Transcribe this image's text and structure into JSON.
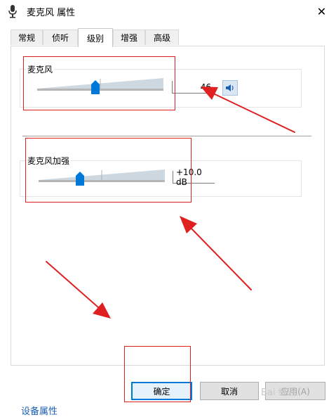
{
  "window": {
    "title": "麦克风 属性",
    "close_symbol": "✕"
  },
  "tabs": [
    {
      "label": "常规",
      "active": false
    },
    {
      "label": "侦听",
      "active": false
    },
    {
      "label": "级别",
      "active": true
    },
    {
      "label": "增强",
      "active": false
    },
    {
      "label": "高级",
      "active": false
    }
  ],
  "levels": {
    "mic": {
      "label": "麦克风",
      "value": "46",
      "level_percent": 46
    },
    "boost": {
      "label": "麦克风加强",
      "value": "+10.0 dB",
      "level_percent": 33
    }
  },
  "buttons": {
    "ok": "确定",
    "cancel": "取消",
    "apply": "应用(A)"
  },
  "footer": {
    "link_text": "设备属性",
    "watermark_text": "Bai 经验"
  },
  "colors": {
    "accent": "#0078d7",
    "annotation": "#e02020"
  },
  "icons": {
    "title": "microphone-icon",
    "mute": "speaker-icon",
    "close": "close-icon"
  }
}
